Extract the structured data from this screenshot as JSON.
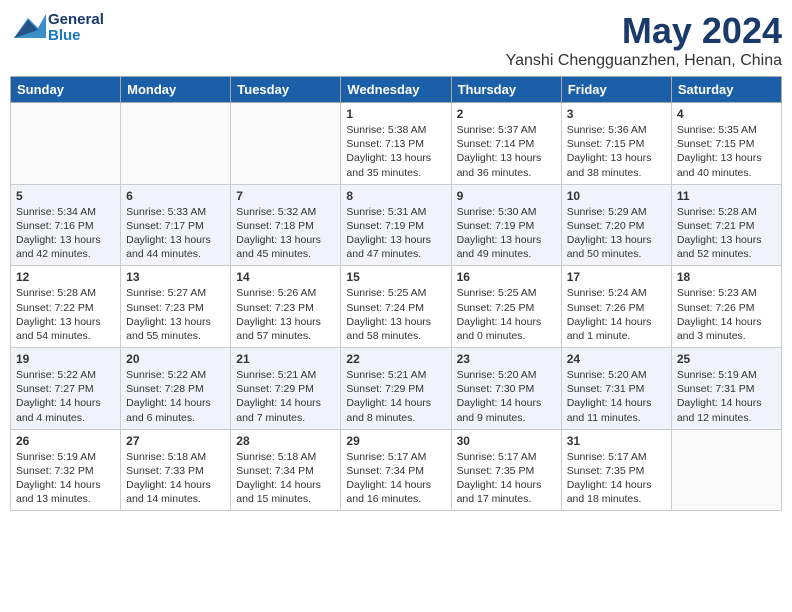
{
  "header": {
    "logo_line1": "General",
    "logo_line2": "Blue",
    "month": "May 2024",
    "location": "Yanshi Chengguanzhen, Henan, China"
  },
  "days_of_week": [
    "Sunday",
    "Monday",
    "Tuesday",
    "Wednesday",
    "Thursday",
    "Friday",
    "Saturday"
  ],
  "weeks": [
    [
      {
        "day": "",
        "content": ""
      },
      {
        "day": "",
        "content": ""
      },
      {
        "day": "",
        "content": ""
      },
      {
        "day": "1",
        "content": "Sunrise: 5:38 AM\nSunset: 7:13 PM\nDaylight: 13 hours\nand 35 minutes."
      },
      {
        "day": "2",
        "content": "Sunrise: 5:37 AM\nSunset: 7:14 PM\nDaylight: 13 hours\nand 36 minutes."
      },
      {
        "day": "3",
        "content": "Sunrise: 5:36 AM\nSunset: 7:15 PM\nDaylight: 13 hours\nand 38 minutes."
      },
      {
        "day": "4",
        "content": "Sunrise: 5:35 AM\nSunset: 7:15 PM\nDaylight: 13 hours\nand 40 minutes."
      }
    ],
    [
      {
        "day": "5",
        "content": "Sunrise: 5:34 AM\nSunset: 7:16 PM\nDaylight: 13 hours\nand 42 minutes."
      },
      {
        "day": "6",
        "content": "Sunrise: 5:33 AM\nSunset: 7:17 PM\nDaylight: 13 hours\nand 44 minutes."
      },
      {
        "day": "7",
        "content": "Sunrise: 5:32 AM\nSunset: 7:18 PM\nDaylight: 13 hours\nand 45 minutes."
      },
      {
        "day": "8",
        "content": "Sunrise: 5:31 AM\nSunset: 7:19 PM\nDaylight: 13 hours\nand 47 minutes."
      },
      {
        "day": "9",
        "content": "Sunrise: 5:30 AM\nSunset: 7:19 PM\nDaylight: 13 hours\nand 49 minutes."
      },
      {
        "day": "10",
        "content": "Sunrise: 5:29 AM\nSunset: 7:20 PM\nDaylight: 13 hours\nand 50 minutes."
      },
      {
        "day": "11",
        "content": "Sunrise: 5:28 AM\nSunset: 7:21 PM\nDaylight: 13 hours\nand 52 minutes."
      }
    ],
    [
      {
        "day": "12",
        "content": "Sunrise: 5:28 AM\nSunset: 7:22 PM\nDaylight: 13 hours\nand 54 minutes."
      },
      {
        "day": "13",
        "content": "Sunrise: 5:27 AM\nSunset: 7:23 PM\nDaylight: 13 hours\nand 55 minutes."
      },
      {
        "day": "14",
        "content": "Sunrise: 5:26 AM\nSunset: 7:23 PM\nDaylight: 13 hours\nand 57 minutes."
      },
      {
        "day": "15",
        "content": "Sunrise: 5:25 AM\nSunset: 7:24 PM\nDaylight: 13 hours\nand 58 minutes."
      },
      {
        "day": "16",
        "content": "Sunrise: 5:25 AM\nSunset: 7:25 PM\nDaylight: 14 hours\nand 0 minutes."
      },
      {
        "day": "17",
        "content": "Sunrise: 5:24 AM\nSunset: 7:26 PM\nDaylight: 14 hours\nand 1 minute."
      },
      {
        "day": "18",
        "content": "Sunrise: 5:23 AM\nSunset: 7:26 PM\nDaylight: 14 hours\nand 3 minutes."
      }
    ],
    [
      {
        "day": "19",
        "content": "Sunrise: 5:22 AM\nSunset: 7:27 PM\nDaylight: 14 hours\nand 4 minutes."
      },
      {
        "day": "20",
        "content": "Sunrise: 5:22 AM\nSunset: 7:28 PM\nDaylight: 14 hours\nand 6 minutes."
      },
      {
        "day": "21",
        "content": "Sunrise: 5:21 AM\nSunset: 7:29 PM\nDaylight: 14 hours\nand 7 minutes."
      },
      {
        "day": "22",
        "content": "Sunrise: 5:21 AM\nSunset: 7:29 PM\nDaylight: 14 hours\nand 8 minutes."
      },
      {
        "day": "23",
        "content": "Sunrise: 5:20 AM\nSunset: 7:30 PM\nDaylight: 14 hours\nand 9 minutes."
      },
      {
        "day": "24",
        "content": "Sunrise: 5:20 AM\nSunset: 7:31 PM\nDaylight: 14 hours\nand 11 minutes."
      },
      {
        "day": "25",
        "content": "Sunrise: 5:19 AM\nSunset: 7:31 PM\nDaylight: 14 hours\nand 12 minutes."
      }
    ],
    [
      {
        "day": "26",
        "content": "Sunrise: 5:19 AM\nSunset: 7:32 PM\nDaylight: 14 hours\nand 13 minutes."
      },
      {
        "day": "27",
        "content": "Sunrise: 5:18 AM\nSunset: 7:33 PM\nDaylight: 14 hours\nand 14 minutes."
      },
      {
        "day": "28",
        "content": "Sunrise: 5:18 AM\nSunset: 7:34 PM\nDaylight: 14 hours\nand 15 minutes."
      },
      {
        "day": "29",
        "content": "Sunrise: 5:17 AM\nSunset: 7:34 PM\nDaylight: 14 hours\nand 16 minutes."
      },
      {
        "day": "30",
        "content": "Sunrise: 5:17 AM\nSunset: 7:35 PM\nDaylight: 14 hours\nand 17 minutes."
      },
      {
        "day": "31",
        "content": "Sunrise: 5:17 AM\nSunset: 7:35 PM\nDaylight: 14 hours\nand 18 minutes."
      },
      {
        "day": "",
        "content": ""
      }
    ]
  ]
}
